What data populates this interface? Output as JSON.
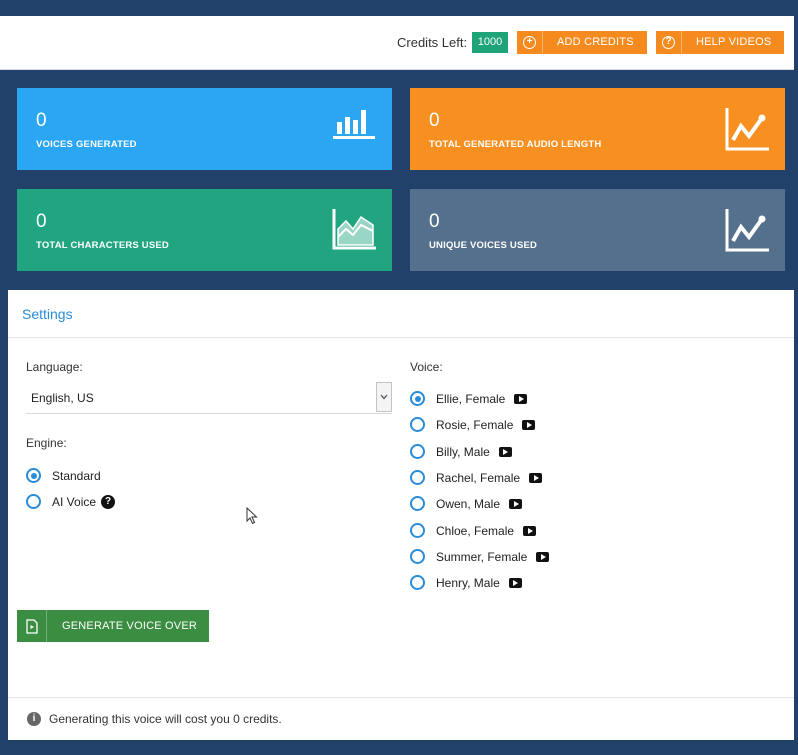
{
  "topbar": {
    "credits_label": "Credits Left:",
    "credits_value": "1000",
    "add_credits": "ADD CREDITS",
    "help_videos": "HELP VIDEOS"
  },
  "stats": [
    {
      "value": "0",
      "label": "VOICES GENERATED",
      "color": "#2aa6f3",
      "icon": "bar-chart-icon"
    },
    {
      "value": "0",
      "label": "TOTAL GENERATED AUDIO LENGTH",
      "color": "#f79021",
      "icon": "line-chart-icon"
    },
    {
      "value": "0",
      "label": "TOTAL CHARACTERS USED",
      "color": "#20a580",
      "icon": "area-chart-icon"
    },
    {
      "value": "0",
      "label": "UNIQUE VOICES USED",
      "color": "#55708d",
      "icon": "line-chart-icon"
    }
  ],
  "settings": {
    "title": "Settings",
    "language_label": "Language:",
    "language_value": "English, US",
    "engine_label": "Engine:",
    "engines": [
      {
        "label": "Standard",
        "selected": true
      },
      {
        "label": "AI Voice",
        "selected": false
      }
    ],
    "voice_label": "Voice:",
    "voices": [
      {
        "label": "Ellie, Female",
        "selected": true
      },
      {
        "label": "Rosie, Female",
        "selected": false
      },
      {
        "label": "Billy, Male",
        "selected": false
      },
      {
        "label": "Rachel, Female",
        "selected": false
      },
      {
        "label": "Owen, Male",
        "selected": false
      },
      {
        "label": "Chloe, Female",
        "selected": false
      },
      {
        "label": "Summer, Female",
        "selected": false
      },
      {
        "label": "Henry, Male",
        "selected": false
      }
    ],
    "generate_button": "GENERATE VOICE OVER",
    "footer_note": "Generating this voice will cost you 0 credits."
  }
}
